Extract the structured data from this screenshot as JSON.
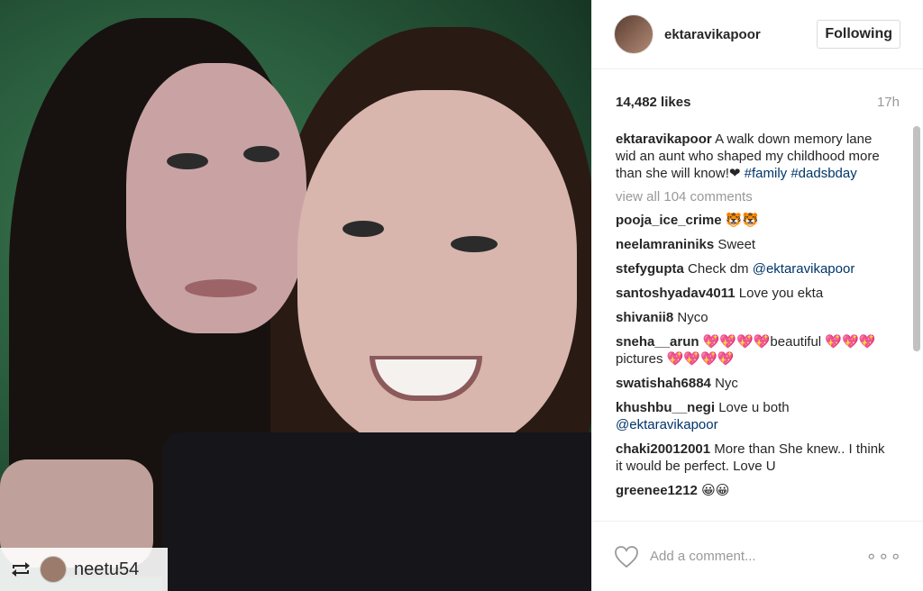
{
  "repost": {
    "username": "neetu54"
  },
  "header": {
    "username": "ektaravikapoor",
    "follow_label": "Following"
  },
  "stats": {
    "likes": "14,482 likes",
    "time": "17h"
  },
  "caption": {
    "user": "ektaravikapoor",
    "text": "A walk down memory lane wid an aunt who shaped my childhood more than she will know!❤",
    "tags": "#family #dadsbday"
  },
  "view_all": "view all 104 comments",
  "comments": [
    {
      "user": "pooja_ice_crime",
      "text": "🐯🐯"
    },
    {
      "user": "neelamraniniks",
      "text": "Sweet"
    },
    {
      "user": "stefygupta",
      "text": "Check dm",
      "mention": "@ektaravikapoor"
    },
    {
      "user": "santoshyadav4011",
      "text": "Love you ekta"
    },
    {
      "user": "shivanii8",
      "text": "Nyco"
    },
    {
      "user": "sneha__arun",
      "text": "💖💖💖💖beautiful 💖💖💖 pictures 💖💖💖💖"
    },
    {
      "user": "swatishah6884",
      "text": "Nyc"
    },
    {
      "user": "khushbu__negi",
      "text": "Love u both",
      "mention": "@ektaravikapoor"
    },
    {
      "user": "chaki20012001",
      "text": "More than She knew.. I think it would be perfect. Love U"
    },
    {
      "user": "greenee1212",
      "text": "😀😀"
    }
  ],
  "footer": {
    "placeholder": "Add a comment...",
    "more_label": "∘∘∘"
  }
}
